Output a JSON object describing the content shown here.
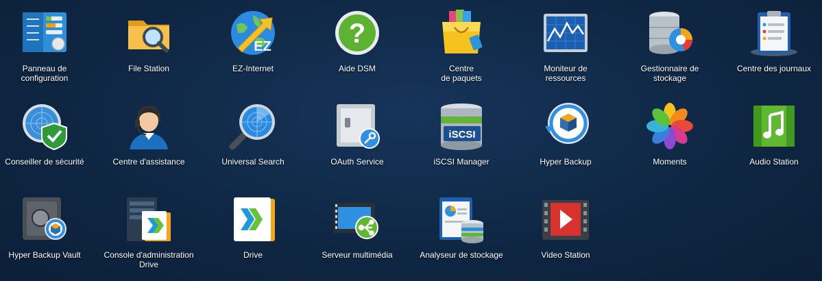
{
  "desktop": {
    "apps": [
      {
        "label": "Panneau de\nconfiguration",
        "icon": "control-panel-icon"
      },
      {
        "label": "File Station",
        "icon": "folder-search-icon"
      },
      {
        "label": "EZ-Internet",
        "icon": "globe-arrow-icon"
      },
      {
        "label": "Aide DSM",
        "icon": "help-icon"
      },
      {
        "label": "Centre\nde paquets",
        "icon": "shopping-bag-icon"
      },
      {
        "label": "Moniteur de\nressources",
        "icon": "monitor-graph-icon"
      },
      {
        "label": "Gestionnaire de\nstockage",
        "icon": "disk-chart-icon"
      },
      {
        "label": "Centre des journaux",
        "icon": "log-clipboard-icon"
      },
      {
        "label": "Conseiller de sécurité",
        "icon": "security-radar-shield-icon"
      },
      {
        "label": "Centre d'assistance",
        "icon": "support-agent-icon"
      },
      {
        "label": "Universal Search",
        "icon": "magnifier-radar-icon"
      },
      {
        "label": "OAuth Service",
        "icon": "vault-key-icon"
      },
      {
        "label": "iSCSI Manager",
        "icon": "iscsi-server-icon"
      },
      {
        "label": "Hyper Backup",
        "icon": "backup-cycle-icon"
      },
      {
        "label": "Moments",
        "icon": "photos-flower-icon"
      },
      {
        "label": "Audio Station",
        "icon": "music-note-icon"
      },
      {
        "label": "Hyper Backup Vault",
        "icon": "safe-backup-icon"
      },
      {
        "label": "Console d'administration\nDrive",
        "icon": "drive-admin-console-icon"
      },
      {
        "label": "Drive",
        "icon": "drive-folder-icon"
      },
      {
        "label": "Serveur multimédia",
        "icon": "media-server-icon"
      },
      {
        "label": "Analyseur de stockage",
        "icon": "storage-analyzer-icon"
      },
      {
        "label": "Video Station",
        "icon": "video-play-icon"
      }
    ]
  }
}
